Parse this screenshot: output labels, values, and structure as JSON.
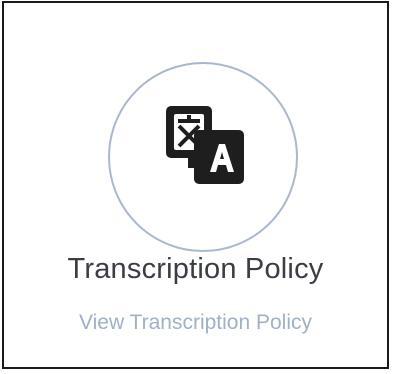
{
  "card": {
    "icon": "translate-icon",
    "title": "Transcription Policy",
    "link_label": "View Transcription Policy"
  },
  "colors": {
    "border": "#1a1a1a",
    "circle_border": "#a9b8cc",
    "title": "#3a3d44",
    "link": "#9fb0c7",
    "icon": "#1e1e1e"
  }
}
